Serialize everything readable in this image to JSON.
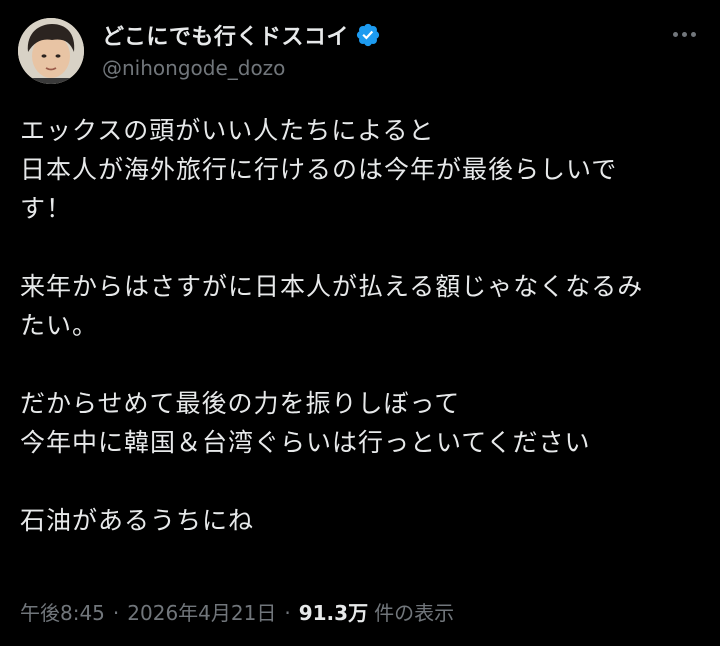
{
  "author": {
    "display_name": "どこにでも行くドスコイ",
    "handle": "@nihongode_dozo",
    "verified_color": "#1d9bf0"
  },
  "more_icon": "more-horizontal-icon",
  "tweet": {
    "paragraphs": [
      [
        "エックスの頭がいい人たちによると",
        "日本人が海外旅行に行けるのは今年が最後らしいで",
        "す！"
      ],
      [
        "来年からはさすがに日本人が払える額じゃなくなるみ",
        "たい。"
      ],
      [
        "だからせめて最後の力を振りしぼって",
        "今年中に韓国＆台湾ぐらいは行っといてください"
      ],
      [
        "石油があるうちにね"
      ]
    ]
  },
  "meta": {
    "time": "午後8:45",
    "separator": "·",
    "date": "2026年4月21日",
    "views_count": "91.3万",
    "views_label": "件の表示"
  },
  "colors": {
    "background": "#000000",
    "text_primary": "#e7e9ea",
    "text_secondary": "#71767b",
    "verified": "#1d9bf0"
  }
}
